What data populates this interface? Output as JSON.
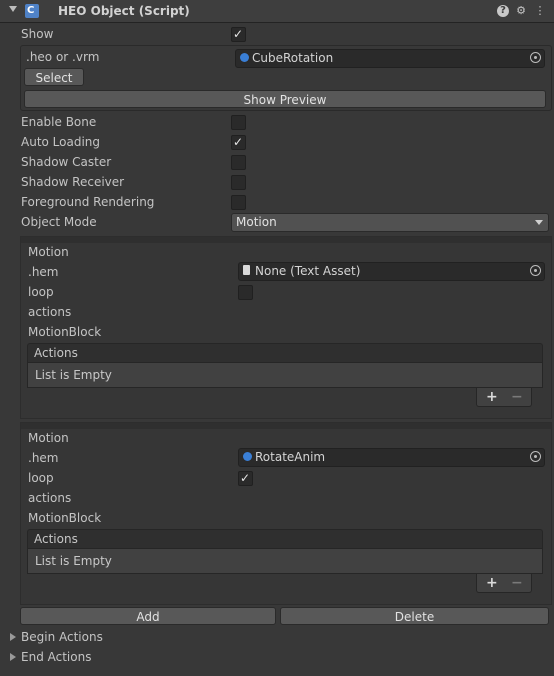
{
  "header": {
    "title": "HEO Object (Script)",
    "enabled_mark": "C"
  },
  "fields": {
    "show": {
      "label": "Show",
      "checked": true
    },
    "heo": {
      "label": ".heo or .vrm",
      "value": "CubeRotation",
      "select_button": "Select",
      "preview_button": "Show Preview"
    },
    "enable_bone": {
      "label": "Enable Bone",
      "checked": false
    },
    "auto_loading": {
      "label": "Auto Loading",
      "checked": true
    },
    "shadow_caster": {
      "label": "Shadow Caster",
      "checked": false
    },
    "shadow_receiver": {
      "label": "Shadow Receiver",
      "checked": false
    },
    "foreground_rendering": {
      "label": "Foreground Rendering",
      "checked": false
    },
    "object_mode": {
      "label": "Object Mode",
      "value": "Motion"
    }
  },
  "motions": [
    {
      "title": "Motion",
      "hem_label": ".hem",
      "hem_value": "None (Text Asset)",
      "loop_label": "loop",
      "loop_checked": false,
      "actions_label": "actions",
      "block_label": "MotionBlock",
      "list_header": "Actions",
      "list_empty": "List is Empty",
      "plus": "+",
      "minus": "−"
    },
    {
      "title": "Motion",
      "hem_label": ".hem",
      "hem_value": "RotateAnim",
      "loop_label": "loop",
      "loop_checked": true,
      "actions_label": "actions",
      "block_label": "MotionBlock",
      "list_header": "Actions",
      "list_empty": "List is Empty",
      "plus": "+",
      "minus": "−"
    }
  ],
  "buttons": {
    "add": "Add",
    "delete": "Delete"
  },
  "foldouts": {
    "begin_actions": "Begin Actions",
    "end_actions": "End Actions"
  },
  "icons": {
    "help": "?",
    "settings": "⚙",
    "menu": "⋮",
    "check": "✓"
  }
}
